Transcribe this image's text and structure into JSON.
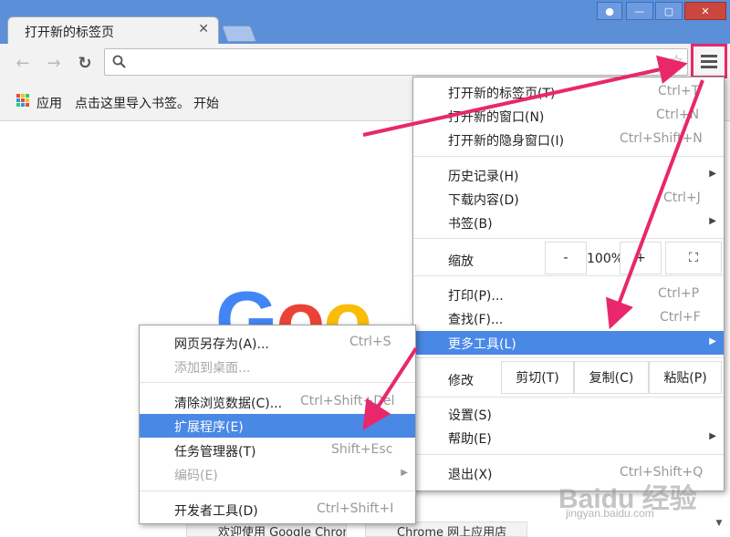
{
  "tab": {
    "title": "打开新的标签页",
    "close": "✕"
  },
  "toolbar": {
    "back_icon": "back-arrow-icon",
    "forward_icon": "forward-arrow-icon",
    "reload_icon": "reload-icon",
    "star_icon": "star-icon",
    "menu_icon": "hamburger-menu-icon"
  },
  "bookmarks": {
    "apps": "应用",
    "import_link": "点击这里导入书签。",
    "start": "开始"
  },
  "page": {
    "logo": "Goo",
    "tile1": "欢迎使用 Google Chrome",
    "tile2": "Chrome 网上应用店"
  },
  "main_menu": {
    "items": [
      {
        "label": "打开新的标签页(T)",
        "shortcut": "Ctrl+T"
      },
      {
        "label": "打开新的窗口(N)",
        "shortcut": "Ctrl+N"
      },
      {
        "label": "打开新的隐身窗口(I)",
        "shortcut": "Ctrl+Shift+N"
      },
      {
        "label": "历史记录(H)"
      },
      {
        "label": "下载内容(D)",
        "shortcut": "Ctrl+J"
      },
      {
        "label": "书签(B)"
      },
      {
        "label": "打印(P)...",
        "shortcut": "Ctrl+P"
      },
      {
        "label": "查找(F)...",
        "shortcut": "Ctrl+F"
      },
      {
        "label": "更多工具(L)"
      },
      {
        "label": "设置(S)"
      },
      {
        "label": "帮助(E)"
      },
      {
        "label": "退出(X)",
        "shortcut": "Ctrl+Shift+Q"
      }
    ],
    "zoom": {
      "label": "缩放",
      "minus": "-",
      "value": "100%",
      "plus": "+"
    },
    "edit": {
      "label": "修改",
      "cut": "剪切(T)",
      "copy": "复制(C)",
      "paste": "粘贴(P)"
    }
  },
  "submenu": {
    "items": [
      {
        "label": "网页另存为(A)...",
        "shortcut": "Ctrl+S"
      },
      {
        "label": "添加到桌面..."
      },
      {
        "label": "清除浏览数据(C)...",
        "shortcut": "Ctrl+Shift+Del"
      },
      {
        "label": "扩展程序(E)"
      },
      {
        "label": "任务管理器(T)",
        "shortcut": "Shift+Esc"
      },
      {
        "label": "编码(E)"
      },
      {
        "label": "开发者工具(D)",
        "shortcut": "Ctrl+Shift+I"
      }
    ]
  },
  "watermark": {
    "text": "Baidu 经验",
    "sub": "jingyan.baidu.com"
  },
  "colors": {
    "highlight": "#4a88e6",
    "annotation": "#e8286b"
  }
}
